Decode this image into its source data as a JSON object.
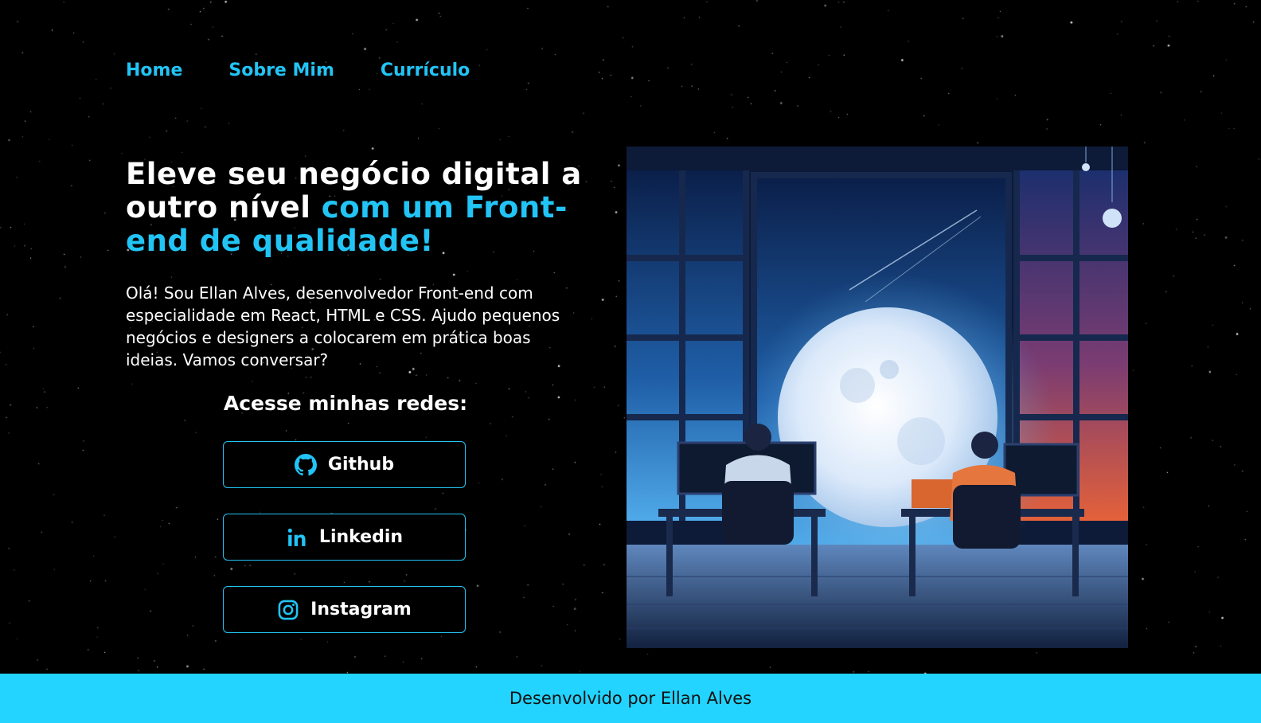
{
  "nav": {
    "items": [
      {
        "label": "Home"
      },
      {
        "label": "Sobre Mim"
      },
      {
        "label": "Currículo"
      }
    ]
  },
  "hero": {
    "headline_white": "Eleve seu negócio digital a outro nível ",
    "headline_accent": "com um Front-end de qualidade!",
    "intro": "Olá! Sou Ellan Alves, desenvolvedor Front-end com especialidade em React, HTML e CSS. Ajudo pequenos negócios e designers a colocarem em prática boas ideias. Vamos conversar?",
    "networks_title": "Acesse minhas redes:",
    "social": [
      {
        "label": "Github",
        "icon": "github-icon"
      },
      {
        "label": "Linkedin",
        "icon": "linkedin-icon"
      },
      {
        "label": "Instagram",
        "icon": "instagram-icon"
      }
    ]
  },
  "footer": {
    "text": "Desenvolvido por Ellan Alves"
  },
  "colors": {
    "accent": "#22c4f5",
    "footer_bg": "#22d4ff",
    "background": "#000000"
  }
}
